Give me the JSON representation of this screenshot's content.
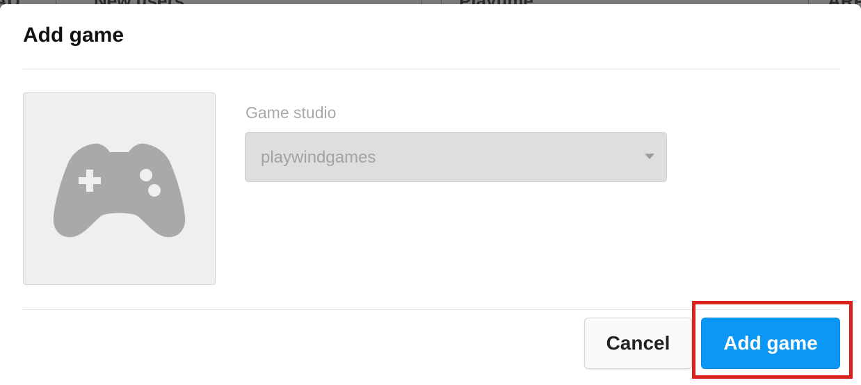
{
  "backdrop": {
    "columns": [
      "MAU",
      "New users",
      "Playtime",
      "ARP"
    ]
  },
  "modal": {
    "title": "Add game",
    "thumbnail_icon": "gamepad-icon",
    "studio_label": "Game studio",
    "studio_value": "playwindgames",
    "studio_caret_icon": "caret-down-icon",
    "cancel_label": "Cancel",
    "submit_label": "Add game"
  },
  "colors": {
    "primary_button": "#0a97f5",
    "highlight_outline": "#d9231c",
    "icon_gray": "#a9a9a9"
  }
}
